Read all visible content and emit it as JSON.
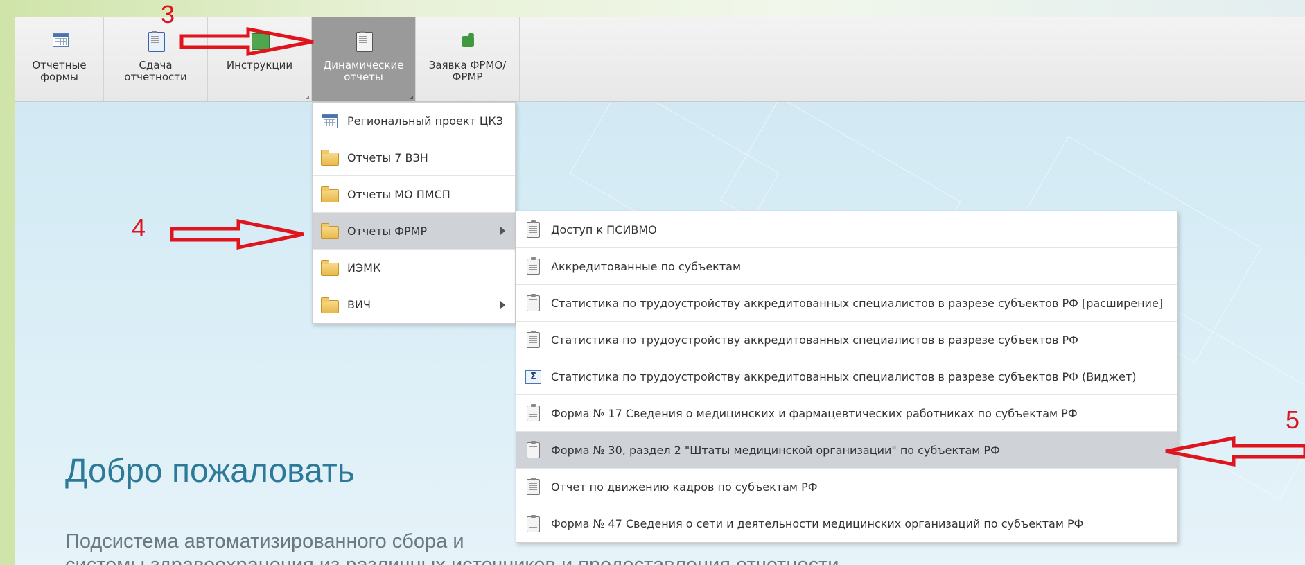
{
  "toolbar": {
    "buttons": [
      {
        "label": "Отчетные\nформы",
        "icon": "report-forms-icon"
      },
      {
        "label": "Сдача\nотчетности",
        "icon": "clipboard-icon"
      },
      {
        "label": "Инструкции",
        "icon": "book-icon"
      },
      {
        "label": "Динамические\nотчеты",
        "icon": "clipboard-icon",
        "active": true
      },
      {
        "label": "Заявка ФРМО/\nФРМР",
        "icon": "puzzle-icon"
      }
    ]
  },
  "menu_level1": {
    "items": [
      {
        "label": "Региональный проект ЦКЗ",
        "icon": "table-icon"
      },
      {
        "label": "Отчеты 7 ВЗН",
        "icon": "folder-icon"
      },
      {
        "label": "Отчеты МО ПМСП",
        "icon": "folder-icon"
      },
      {
        "label": "Отчеты ФРМР",
        "icon": "folder-icon",
        "highlighted": true,
        "submenu": true
      },
      {
        "label": "ИЭМК",
        "icon": "folder-icon"
      },
      {
        "label": "ВИЧ",
        "icon": "folder-icon",
        "submenu": true
      }
    ]
  },
  "menu_level2": {
    "items": [
      {
        "label": "Доступ к ПСИВМО",
        "icon": "clipboard-icon"
      },
      {
        "label": "Аккредитованные по субъектам",
        "icon": "clipboard-icon"
      },
      {
        "label": "Статистика по трудоустройству аккредитованных специалистов в разрезе субъектов РФ [расширение]",
        "icon": "clipboard-icon"
      },
      {
        "label": "Статистика по трудоустройству аккредитованных специалистов в разрезе субъектов РФ",
        "icon": "clipboard-icon"
      },
      {
        "label": "Статистика по трудоустройству аккредитованных специалистов в разрезе субъектов РФ (Виджет)",
        "icon": "sigma-icon"
      },
      {
        "label": "Форма № 17 Сведения о медицинских и фармацевтических работниках по субъектам РФ",
        "icon": "clipboard-icon"
      },
      {
        "label": "Форма № 30, раздел 2 \"Штаты медицинской организации\" по субъектам РФ",
        "icon": "clipboard-icon",
        "highlighted": true
      },
      {
        "label": "Отчет по движению кадров по субъектам РФ",
        "icon": "clipboard-icon"
      },
      {
        "label": "Форма № 47 Сведения о сети и деятельности медицинских организаций по субъектам РФ",
        "icon": "clipboard-icon"
      }
    ]
  },
  "welcome": {
    "title": "Добро пожаловать",
    "subtitle_line1": "Подсистема автоматизированного сбора и",
    "subtitle_line2": "системы здравоохранения из различных источников и предоставления отчетности"
  },
  "annotations": {
    "step3": "3",
    "step4": "4",
    "step5": "5",
    "arrow_color": "#e0141c"
  }
}
